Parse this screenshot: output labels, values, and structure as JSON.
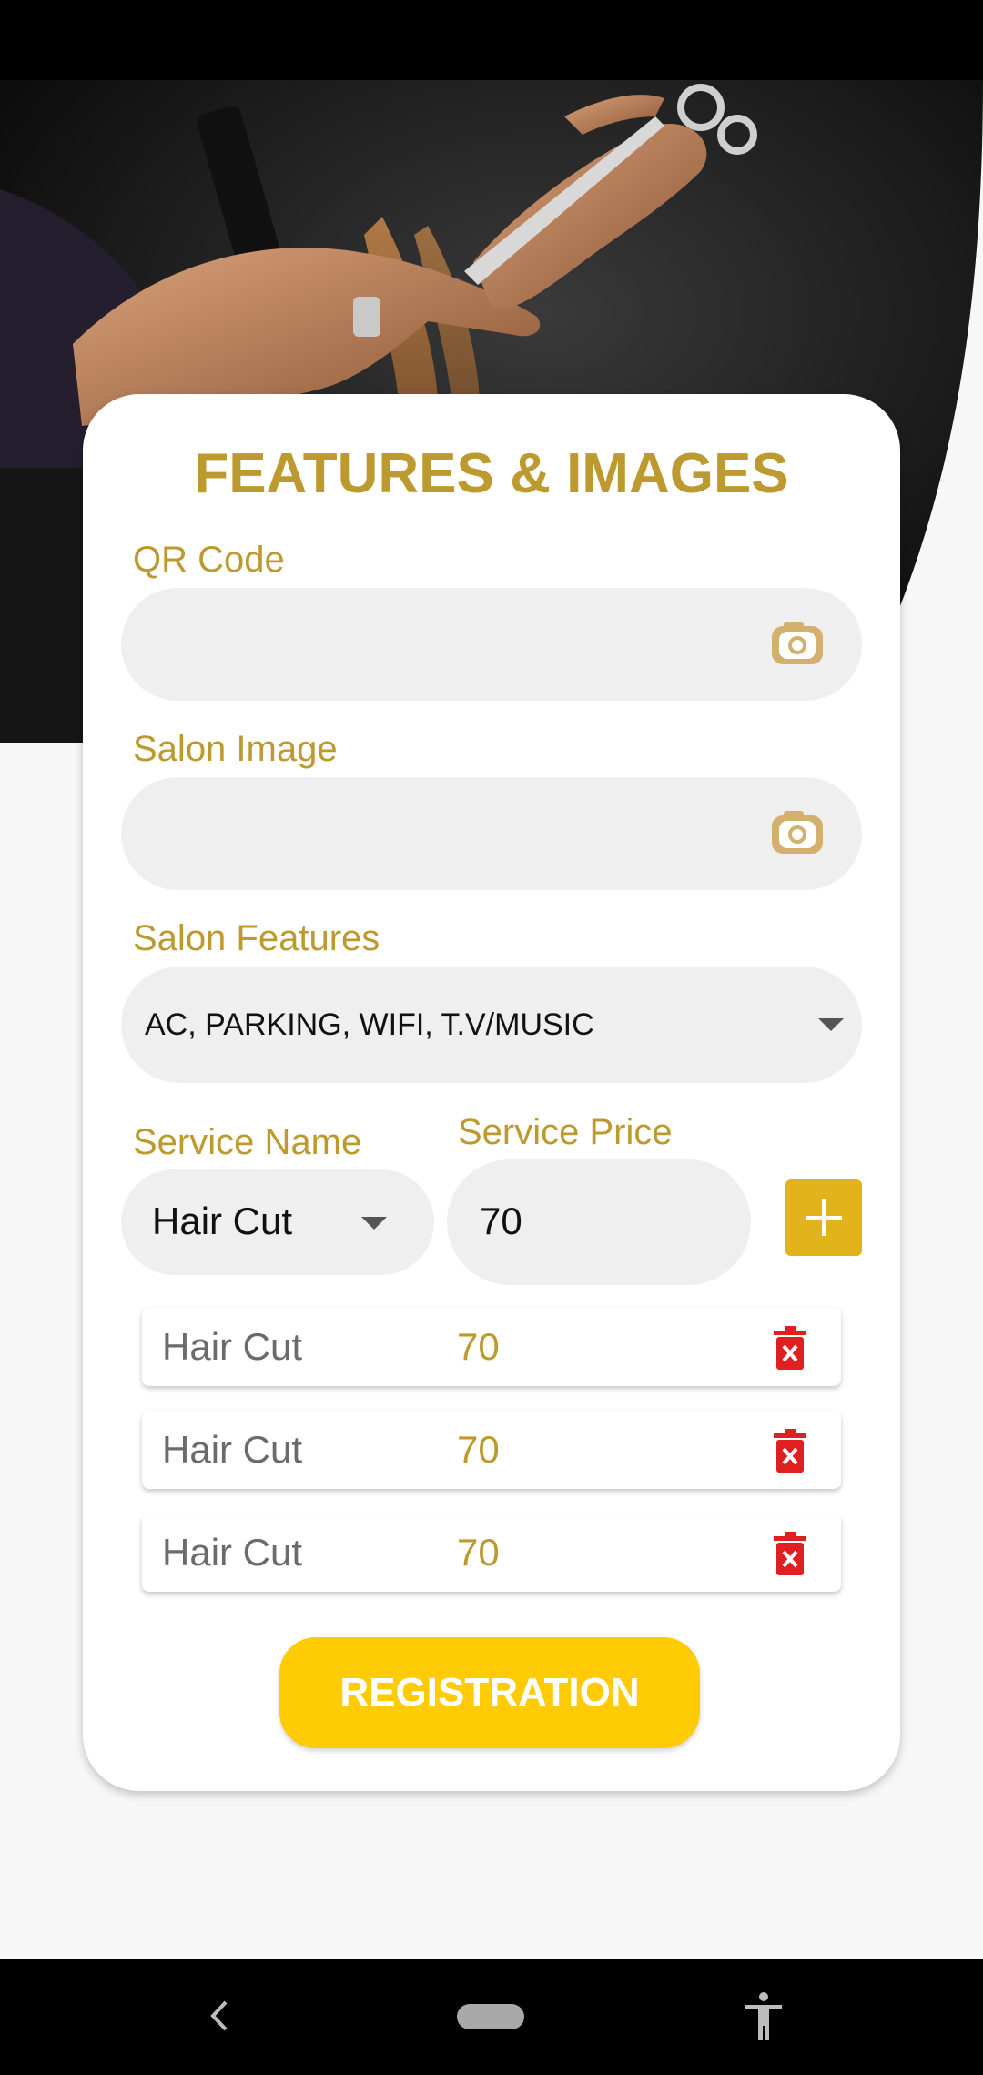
{
  "form": {
    "title": "FEATURES & IMAGES",
    "qr_code": {
      "label": "QR Code",
      "value": "",
      "icon": "camera-icon"
    },
    "salon_image": {
      "label": "Salon Image",
      "value": "",
      "icon": "camera-icon"
    },
    "salon_features": {
      "label": "Salon Features",
      "value": "AC, PARKING, WIFI, T.V/MUSIC"
    },
    "service_name": {
      "label": "Service Name",
      "value": "Hair Cut"
    },
    "service_price": {
      "label": "Service Price",
      "value": "70"
    },
    "add_button_icon": "plus-icon"
  },
  "services": [
    {
      "name": "Hair Cut",
      "price": "70"
    },
    {
      "name": "Hair Cut",
      "price": "70"
    },
    {
      "name": "Hair Cut",
      "price": "70"
    }
  ],
  "registration_label": "REGISTRATION",
  "colors": {
    "accent_gold": "#bd9a2f",
    "button_yellow": "#ffcb05",
    "add_button": "#e0b41a",
    "delete_red": "#e02020",
    "field_bg": "#efefef"
  },
  "nav": {
    "back_icon": "back-icon",
    "home_icon": "home-pill-icon",
    "accessibility_icon": "accessibility-icon"
  }
}
